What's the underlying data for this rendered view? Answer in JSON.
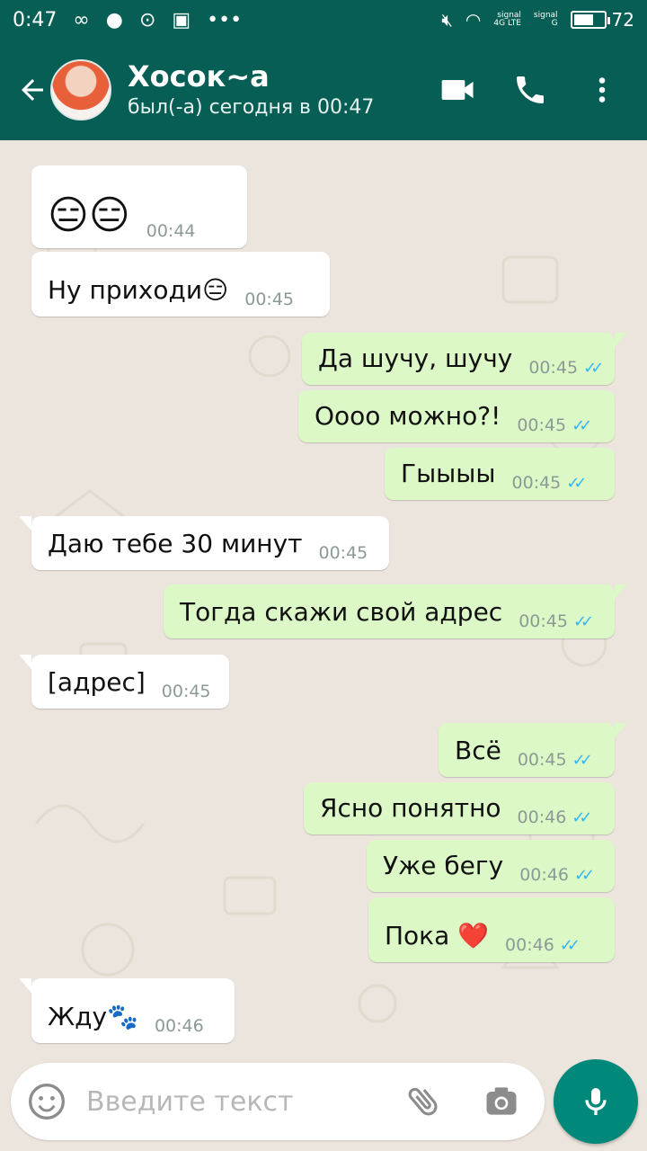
{
  "status": {
    "time": "0:47",
    "network_4g": "4G",
    "network_lte": "LTE",
    "network_g": "G",
    "signal_label": "signal",
    "battery": "72",
    "battery_level": 0.72
  },
  "header": {
    "name": "Хосок~a",
    "last_seen": "был(-а) сегодня в 00:47"
  },
  "messages": [
    {
      "text": "😑😑",
      "time": "00:44",
      "dir": "in"
    },
    {
      "text": "Ну приходи😑",
      "time": "00:45",
      "dir": "in"
    },
    {
      "text": "Да шучу, шучу",
      "time": "00:45",
      "dir": "out"
    },
    {
      "text": "Оооо можно?!",
      "time": "00:45",
      "dir": "out"
    },
    {
      "text": "Гыыыы",
      "time": "00:45",
      "dir": "out"
    },
    {
      "text": "Даю тебе 30 минут",
      "time": "00:45",
      "dir": "in"
    },
    {
      "text": "Тогда скажи свой адрес",
      "time": "00:45",
      "dir": "out"
    },
    {
      "text": "[адрес]",
      "time": "00:45",
      "dir": "in"
    },
    {
      "text": "Всё",
      "time": "00:45",
      "dir": "out"
    },
    {
      "text": "Ясно понятно",
      "time": "00:46",
      "dir": "out"
    },
    {
      "text": "Уже бегу",
      "time": "00:46",
      "dir": "out"
    },
    {
      "text": "Пока ❤️",
      "time": "00:46",
      "dir": "out"
    },
    {
      "text": "Жду🐾",
      "time": "00:46",
      "dir": "in"
    }
  ],
  "input": {
    "placeholder": "Введите текст"
  },
  "icons": {
    "back": "arrow-left-icon",
    "video": "video-call-icon",
    "call": "phone-icon",
    "menu": "more-vertical-icon",
    "emoji": "emoji-icon",
    "attach": "paperclip-icon",
    "camera": "camera-icon",
    "mic": "microphone-icon",
    "read": "double-check-icon"
  },
  "colors": {
    "toolbar": "#075e54",
    "outgoing_bubble": "#dcf8c6",
    "incoming_bubble": "#ffffff",
    "read_ticks": "#34b7f1",
    "mic_button": "#00897b"
  }
}
